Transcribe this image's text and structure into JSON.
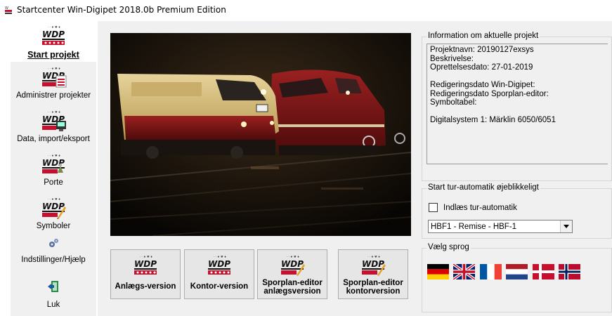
{
  "window": {
    "title": "Startcenter Win-Digipet 2018.0b Premium Edition"
  },
  "sidebar": {
    "items": [
      {
        "label": "Start projekt",
        "icon": "wdp-logo-icon",
        "active": true
      },
      {
        "label": "Administrer projekter",
        "icon": "wdp-projects-icon",
        "active": false
      },
      {
        "label": "Data, import/eksport",
        "icon": "wdp-data-icon",
        "active": false
      },
      {
        "label": "Porte",
        "icon": "wdp-ports-icon",
        "active": false
      },
      {
        "label": "Symboler",
        "icon": "wdp-symbols-icon",
        "active": false
      },
      {
        "label": "Indstillinger/Hjælp",
        "icon": "gears-icon",
        "active": false
      },
      {
        "label": "Luk",
        "icon": "exit-door-icon",
        "active": false
      }
    ]
  },
  "logo_text": "WDP",
  "project_info": {
    "legend": "Information om aktuelle projekt",
    "lines": [
      "Projektnavn: 20190127exsys",
      "Beskrivelse:",
      "Oprettelsesdato: 27-01-2019",
      "",
      "Redigeringsdato Win-Digipet:",
      "Redigeringsdato Sporplan-editor:",
      "Symboltabel:",
      "",
      "Digitalsystem 1: Märklin 6050/6051"
    ]
  },
  "autostart": {
    "legend": "Start tur-automatik øjeblikkeligt",
    "checkbox_label": "Indlæs tur-automatik",
    "checked": false,
    "selected": "HBF1 - Remise - HBF-1"
  },
  "language": {
    "legend": "Vælg sprog",
    "flags": [
      "german-flag-icon",
      "uk-flag-icon",
      "french-flag-icon",
      "dutch-flag-icon",
      "danish-flag-icon",
      "norwegian-flag-icon"
    ]
  },
  "buttons": [
    {
      "line1": "Anlægs-version",
      "line2": ""
    },
    {
      "line1": "Kontor-version",
      "line2": ""
    },
    {
      "line1": "Sporplan-editor",
      "line2": "anlægsversion"
    },
    {
      "line1": "Sporplan-editor",
      "line2": "kontorversion"
    }
  ],
  "colors": {
    "panel": "#f0f0f0",
    "logo_red": "#c8102e",
    "locomotive_cream": "#d8c07a",
    "locomotive_red": "#7a1414"
  }
}
